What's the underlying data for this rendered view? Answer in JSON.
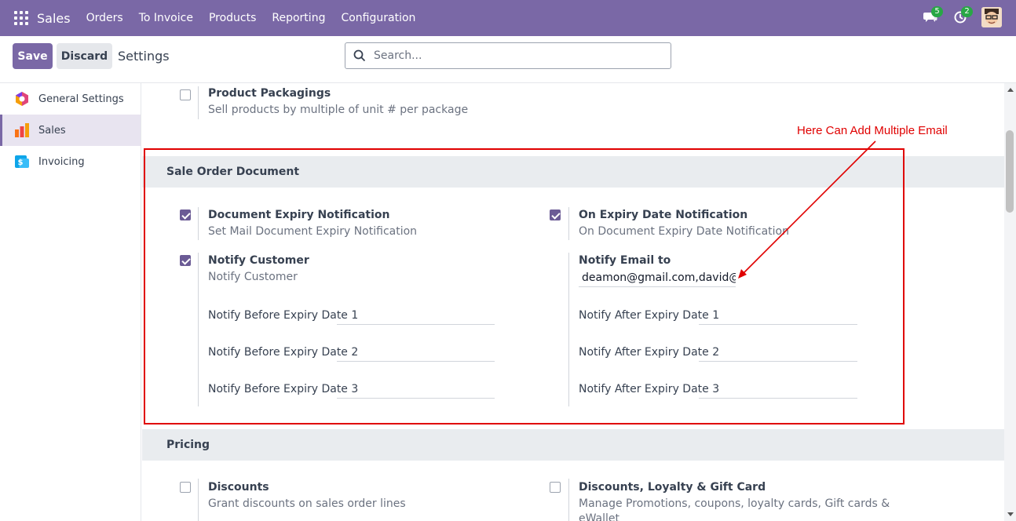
{
  "navbar": {
    "brand": "Sales",
    "menu": [
      "Orders",
      "To Invoice",
      "Products",
      "Reporting",
      "Configuration"
    ],
    "chat_count": "5",
    "activity_count": "2"
  },
  "control": {
    "save_label": "Save",
    "discard_label": "Discard",
    "title": "Settings",
    "search_placeholder": "Search..."
  },
  "sidebar": {
    "items": [
      {
        "label": "General Settings",
        "icon": "settings-hexagon-icon"
      },
      {
        "label": "Sales",
        "icon": "sales-chart-icon"
      },
      {
        "label": "Invoicing",
        "icon": "invoice-icon"
      }
    ]
  },
  "top_setting": {
    "label": "Product Packagings",
    "desc": "Sell products by multiple of unit # per package"
  },
  "sale_order_document": {
    "title": "Sale Order Document",
    "doc_expiry": {
      "label": "Document Expiry Notification",
      "desc": "Set Mail Document Expiry Notification"
    },
    "expiry_date": {
      "label": "On Expiry Date Notification",
      "desc": "On Document Expiry Date Notification"
    },
    "notify_customer": {
      "label": "Notify Customer",
      "desc": "Notify Customer"
    },
    "notify_email": {
      "label": "Notify Email to",
      "value": "deamon@gmail.com,david@gr"
    },
    "before_1": "Notify Before Expiry Date 1",
    "before_2": "Notify Before Expiry Date 2",
    "before_3": "Notify Before Expiry Date 3",
    "after_1": "Notify After Expiry Date 1",
    "after_2": "Notify After Expiry Date 2",
    "after_3": "Notify After Expiry Date 3"
  },
  "pricing": {
    "title": "Pricing",
    "discounts": {
      "label": "Discounts",
      "desc": "Grant discounts on sales order lines"
    },
    "loyalty": {
      "label": "Discounts, Loyalty & Gift Card",
      "desc": "Manage Promotions, coupons, loyalty cards, Gift cards &",
      "desc2": "eWallet"
    }
  },
  "annotation": {
    "text": "Here Can Add Multiple Email"
  },
  "colors": {
    "brand": "#7a68a6",
    "annotation": "#e00000",
    "checkbox": "#6b5b95"
  }
}
